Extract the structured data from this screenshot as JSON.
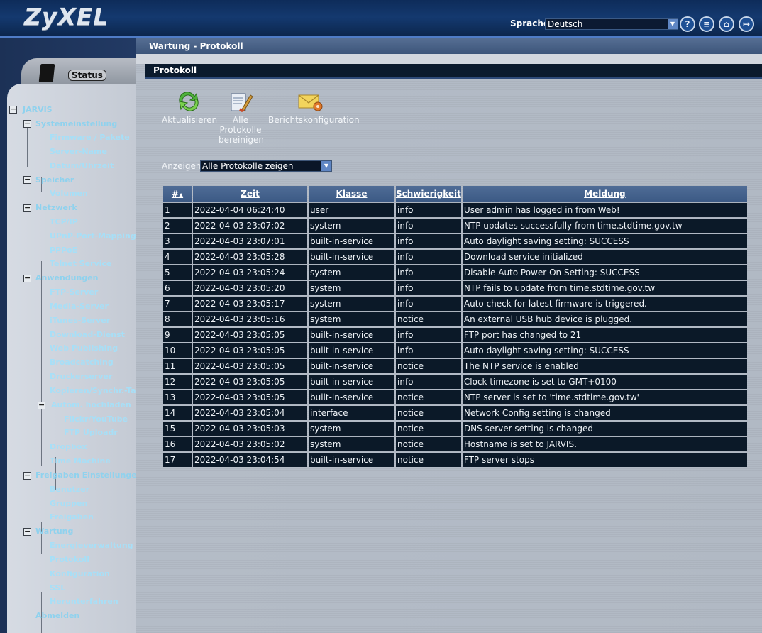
{
  "header": {
    "logo": "ZyXEL",
    "language_label": "Sprache:",
    "language_value": "Deutsch"
  },
  "sidebar": {
    "status_tab": "Status",
    "tree": [
      {
        "label": "JARVIS"
      },
      {
        "label": "Systemeinstellung"
      },
      {
        "label": "Firmware / Pakete"
      },
      {
        "label": "Server-Name"
      },
      {
        "label": "Datum/Uhrzeit"
      },
      {
        "label": "Speicher"
      },
      {
        "label": "Volumen"
      },
      {
        "label": "Netzwerk"
      },
      {
        "label": "TCP/IP"
      },
      {
        "label": "UPnP-Port-Mapping"
      },
      {
        "label": "PPPoE"
      },
      {
        "label": "Telnet Service"
      },
      {
        "label": "Anwendungen"
      },
      {
        "label": "FTP-Server"
      },
      {
        "label": "Media-Server"
      },
      {
        "label": "iTunes-Server"
      },
      {
        "label": "Download-Dienst"
      },
      {
        "label": "Web Publishing"
      },
      {
        "label": "Broadcatching"
      },
      {
        "label": "Druckerserver"
      },
      {
        "label": "Kopieren/Synchr.-Tas"
      },
      {
        "label": "Autom. hochladen"
      },
      {
        "label": "Flickr/YouTube"
      },
      {
        "label": "FTP Uploadr"
      },
      {
        "label": "Dropbox"
      },
      {
        "label": "Time Machine"
      },
      {
        "label": "Freigaben Einstellungen"
      },
      {
        "label": "Benutzer"
      },
      {
        "label": "Gruppen"
      },
      {
        "label": "Freigaben"
      },
      {
        "label": "Wartung"
      },
      {
        "label": "Energieverwaltung"
      },
      {
        "label": "Protokoll"
      },
      {
        "label": "Konfiguration"
      },
      {
        "label": "SSL"
      },
      {
        "label": "Herunterfahren"
      },
      {
        "label": "Abmelden"
      }
    ]
  },
  "main": {
    "breadcrumb": "Wartung - Protokoll",
    "section_title": "Protokoll",
    "toolbar": {
      "refresh": "Aktualisieren",
      "clear_1": "Alle",
      "clear_2": "Protokolle",
      "clear_3": "bereinigen",
      "report": "Berichtskonfiguration"
    },
    "filter": {
      "label": "Anzeigen:",
      "value": "Alle Protokolle zeigen"
    },
    "table": {
      "columns": [
        "#",
        "Zeit",
        "Klasse",
        "Schwierigkeit",
        "Meldung"
      ],
      "rows": [
        [
          "1",
          "2022-04-04 06:24:40",
          "user",
          "info",
          "User admin has logged in from Web!"
        ],
        [
          "2",
          "2022-04-03 23:07:02",
          "system",
          "info",
          "NTP updates successfully from time.stdtime.gov.tw"
        ],
        [
          "3",
          "2022-04-03 23:07:01",
          "built-in-service",
          "info",
          "Auto daylight saving setting: SUCCESS"
        ],
        [
          "4",
          "2022-04-03 23:05:28",
          "built-in-service",
          "info",
          "Download service initialized"
        ],
        [
          "5",
          "2022-04-03 23:05:24",
          "system",
          "info",
          "Disable Auto Power-On Setting: SUCCESS"
        ],
        [
          "6",
          "2022-04-03 23:05:20",
          "system",
          "info",
          "NTP fails to update from time.stdtime.gov.tw"
        ],
        [
          "7",
          "2022-04-03 23:05:17",
          "system",
          "info",
          "Auto check for latest firmware is triggered."
        ],
        [
          "8",
          "2022-04-03 23:05:16",
          "system",
          "notice",
          "An external USB hub device is plugged."
        ],
        [
          "9",
          "2022-04-03 23:05:05",
          "built-in-service",
          "info",
          "FTP port has changed to 21"
        ],
        [
          "10",
          "2022-04-03 23:05:05",
          "built-in-service",
          "info",
          "Auto daylight saving setting: SUCCESS"
        ],
        [
          "11",
          "2022-04-03 23:05:05",
          "built-in-service",
          "notice",
          "The NTP service is enabled"
        ],
        [
          "12",
          "2022-04-03 23:05:05",
          "built-in-service",
          "info",
          "Clock timezone is set to GMT+0100"
        ],
        [
          "13",
          "2022-04-03 23:05:05",
          "built-in-service",
          "notice",
          "NTP server is set to 'time.stdtime.gov.tw'"
        ],
        [
          "14",
          "2022-04-03 23:05:04",
          "interface",
          "notice",
          "Network Config setting is changed"
        ],
        [
          "15",
          "2022-04-03 23:05:03",
          "system",
          "notice",
          "DNS server setting is changed"
        ],
        [
          "16",
          "2022-04-03 23:05:02",
          "system",
          "notice",
          "Hostname is set to JARVIS."
        ],
        [
          "17",
          "2022-04-03 23:04:54",
          "built-in-service",
          "notice",
          "FTP server stops"
        ]
      ]
    }
  },
  "icons": {
    "header": [
      "help-icon",
      "notes-icon",
      "home-icon",
      "logout-icon"
    ],
    "toolbar": [
      "refresh-icon",
      "clear-logs-icon",
      "mail-report-icon"
    ]
  },
  "colors": {
    "header_bg": "#14396f",
    "tree_text": "#8fd2ee",
    "table_row_bg": "#0b1928",
    "table_header_bg": "#3c5a85"
  }
}
